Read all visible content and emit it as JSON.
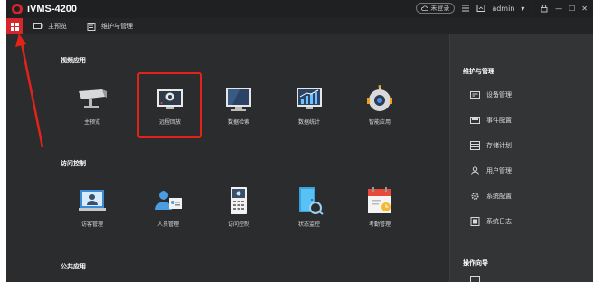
{
  "app": {
    "title": "iVMS-4200"
  },
  "titlebar": {
    "login_status": "未登录",
    "user": "admin",
    "user_caret": "▾",
    "sep": "|",
    "minimize": "—",
    "maximize": "☐",
    "close": "✕"
  },
  "tabs": [
    {
      "label": "主预览",
      "icon": "monitor-icon"
    },
    {
      "label": "维护与管理",
      "icon": "wrench-icon"
    }
  ],
  "sections": {
    "video": {
      "title": "视频应用",
      "items": [
        {
          "label": "主预览",
          "icon": "camera-icon"
        },
        {
          "label": "远程回放",
          "icon": "playback-icon"
        },
        {
          "label": "数据检索",
          "icon": "search-monitor-icon"
        },
        {
          "label": "数据统计",
          "icon": "stats-icon"
        },
        {
          "label": "智能应用",
          "icon": "robot-icon"
        }
      ]
    },
    "access": {
      "title": "访问控制",
      "items": [
        {
          "label": "访客管理",
          "icon": "visitor-icon"
        },
        {
          "label": "人员管理",
          "icon": "person-card-icon"
        },
        {
          "label": "访问控制",
          "icon": "intercom-icon"
        },
        {
          "label": "状态监控",
          "icon": "door-monitor-icon"
        },
        {
          "label": "考勤管理",
          "icon": "calendar-icon"
        }
      ]
    },
    "public": {
      "title": "公共应用"
    }
  },
  "sidebar": {
    "title": "维护与管理",
    "items": [
      {
        "label": "设备管理",
        "icon": "device-icon"
      },
      {
        "label": "事件配置",
        "icon": "event-icon"
      },
      {
        "label": "存储计划",
        "icon": "storage-icon"
      },
      {
        "label": "用户管理",
        "icon": "user-icon"
      },
      {
        "label": "系统配置",
        "icon": "settings-icon"
      },
      {
        "label": "系统日志",
        "icon": "log-icon"
      }
    ],
    "guide_title": "操作向导"
  },
  "colors": {
    "accent": "#d6262c",
    "background": "#2b2c2e",
    "sidebar": "#333436"
  }
}
